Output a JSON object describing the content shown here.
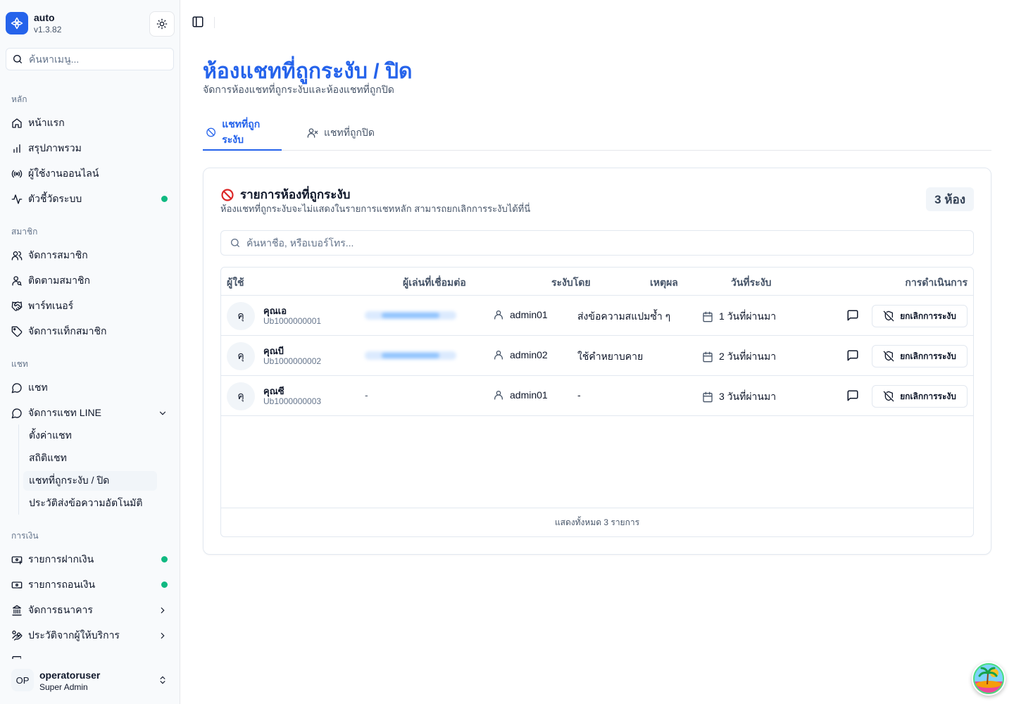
{
  "app": {
    "name": "auto",
    "version": "v1.3.82"
  },
  "sidebar": {
    "search_placeholder": "ค้นหาเมนู...",
    "groups": {
      "main": "หลัก",
      "members": "สมาชิก",
      "chat": "แชท",
      "finance": "การเงิน"
    },
    "items": {
      "home": "หน้าแรก",
      "overview": "สรุปภาพรวม",
      "online_users": "ผู้ใช้งานออนไลน์",
      "metrics": "ตัวชี้วัดระบบ",
      "manage_members": "จัดการสมาชิก",
      "track_members": "ติดตามสมาชิก",
      "partners": "พาร์ทเนอร์",
      "member_tags": "จัดการแท็กสมาชิก",
      "chat": "แชท",
      "line_chat": "จัดการแชท LINE",
      "deposits": "รายการฝากเงิน",
      "withdrawals": "รายการถอนเงิน",
      "banks": "จัดการธนาคาร",
      "provider_history": "ประวัติจากผู้ให้บริการ"
    },
    "sub_items": {
      "chat_settings": "ตั้งค่าแชท",
      "chat_stats": "สถิติแชท",
      "suspended_chats": "แชทที่ถูกระงับ / ปิด",
      "auto_message_history": "ประวัติส่งข้อความอัตโนมัติ"
    },
    "user": {
      "initials": "OP",
      "name": "operatoruser",
      "role": "Super Admin"
    }
  },
  "page": {
    "title": "ห้องแชทที่ถูกระงับ / ปิด",
    "subtitle": "จัดการห้องแชทที่ถูกระงับและห้องแชทที่ถูกปิด",
    "tabs": [
      "แชทที่ถูกระงับ",
      "แชทที่ถูกปิด"
    ]
  },
  "card": {
    "title": "รายการห้องที่ถูกระงับ",
    "description": "ห้องแชทที่ถูกระงับจะไม่แสดงในรายการแชทหลัก สามารถยกเลิกการระงับได้ที่นี่",
    "count_badge": "3 ห้อง",
    "search_placeholder": "ค้นหาชื่อ, หรือเบอร์โทร...",
    "columns": [
      "ผู้ใช้",
      "ผู้เล่นที่เชื่อมต่อ",
      "ระงับโดย",
      "เหตุผล",
      "วันที่ระงับ",
      "การดำเนินการ"
    ],
    "rows": [
      {
        "initial": "คุ",
        "name": "คุณเอ",
        "uid": "Ub1000000001",
        "player": "",
        "banned_by": "admin01",
        "reason": "ส่งข้อความสแปมซ้ำ ๆ",
        "date": "1 วันที่ผ่านมา",
        "action": "ยกเลิกการระงับ"
      },
      {
        "initial": "คุ",
        "name": "คุณบี",
        "uid": "Ub1000000002",
        "player": "",
        "banned_by": "admin02",
        "reason": "ใช้คำหยาบคาย",
        "date": "2 วันที่ผ่านมา",
        "action": "ยกเลิกการระงับ"
      },
      {
        "initial": "คุ",
        "name": "คุณซี",
        "uid": "Ub1000000003",
        "player": "-",
        "banned_by": "admin01",
        "reason": "-",
        "date": "3 วันที่ผ่านมา",
        "action": "ยกเลิกการระงับ"
      }
    ],
    "footer": "แสดงทั้งหมด 3 รายการ"
  },
  "colors": {
    "accent": "#2563eb",
    "online_dot": "#10b981",
    "ban_icon": "#dc2626"
  }
}
